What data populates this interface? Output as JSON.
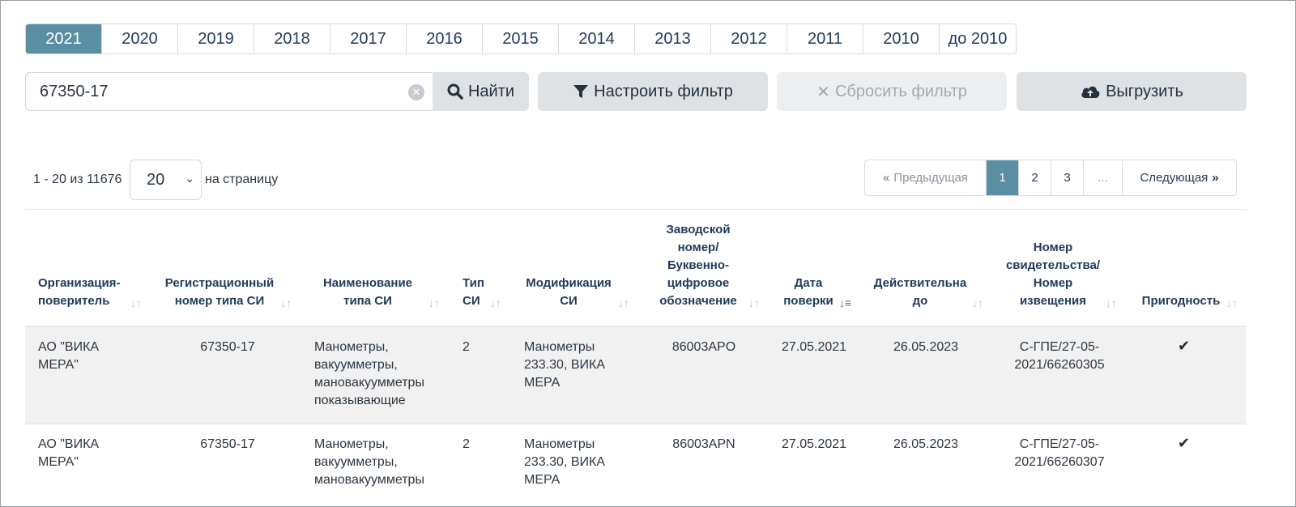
{
  "years": [
    "2021",
    "2020",
    "2019",
    "2018",
    "2017",
    "2016",
    "2015",
    "2014",
    "2013",
    "2012",
    "2011",
    "2010",
    "до 2010"
  ],
  "active_year": "2021",
  "search": {
    "value": "67350-17"
  },
  "buttons": {
    "find": "Найти",
    "filter": "Настроить фильтр",
    "reset": "Сбросить фильтр",
    "export": "Выгрузить"
  },
  "pagination": {
    "range": "1 - 20 из 11676",
    "per_page": "20",
    "per_page_label": "на страницу",
    "prev": "Предыдущая",
    "pages": [
      "1",
      "2",
      "3"
    ],
    "ellipsis": "...",
    "current_page": "1",
    "next": "Следующая"
  },
  "table": {
    "headers": {
      "org": [
        "Организация-",
        "поверитель"
      ],
      "reg": [
        "Регистрационный",
        "номер типа СИ"
      ],
      "name": [
        "Наименование",
        "типа СИ"
      ],
      "type": [
        "Тип",
        "СИ"
      ],
      "mod": [
        "Модификация",
        "СИ"
      ],
      "serial": [
        "Заводской",
        "номер/",
        "Буквенно-",
        "цифровое",
        "обозначение"
      ],
      "date": [
        "Дата",
        "поверки"
      ],
      "valid": [
        "Действительна",
        "до"
      ],
      "cert": [
        "Номер",
        "свидетельства/",
        "Номер",
        "извещения"
      ],
      "fit": [
        "Пригодность"
      ]
    },
    "rows": [
      {
        "org": [
          "АО \"ВИКА",
          "МЕРА\""
        ],
        "reg": "67350-17",
        "name": [
          "Манометры,",
          "вакуумметры,",
          "мановакуумметры",
          "показывающие"
        ],
        "type": "2",
        "mod": [
          "Манометры",
          "233.30, ВИКА",
          "МЕРА"
        ],
        "serial": "86003APO",
        "date": "27.05.2021",
        "valid": "26.05.2023",
        "cert": [
          "С-ГПЕ/27-05-",
          "2021/66260305"
        ],
        "fit": "✔"
      },
      {
        "org": [
          "АО \"ВИКА",
          "МЕРА\""
        ],
        "reg": "67350-17",
        "name": [
          "Манометры,",
          "вакуумметры,",
          "мановакуумметры"
        ],
        "type": "2",
        "mod": [
          "Манометры",
          "233.30, ВИКА",
          "МЕРА"
        ],
        "serial": "86003APN",
        "date": "27.05.2021",
        "valid": "26.05.2023",
        "cert": [
          "С-ГПЕ/27-05-",
          "2021/66260307"
        ],
        "fit": "✔"
      }
    ]
  },
  "colors": {
    "accent": "#5a8ea3",
    "button_bg": "#dfe2e5",
    "row_shade": "#f1f1f1"
  }
}
